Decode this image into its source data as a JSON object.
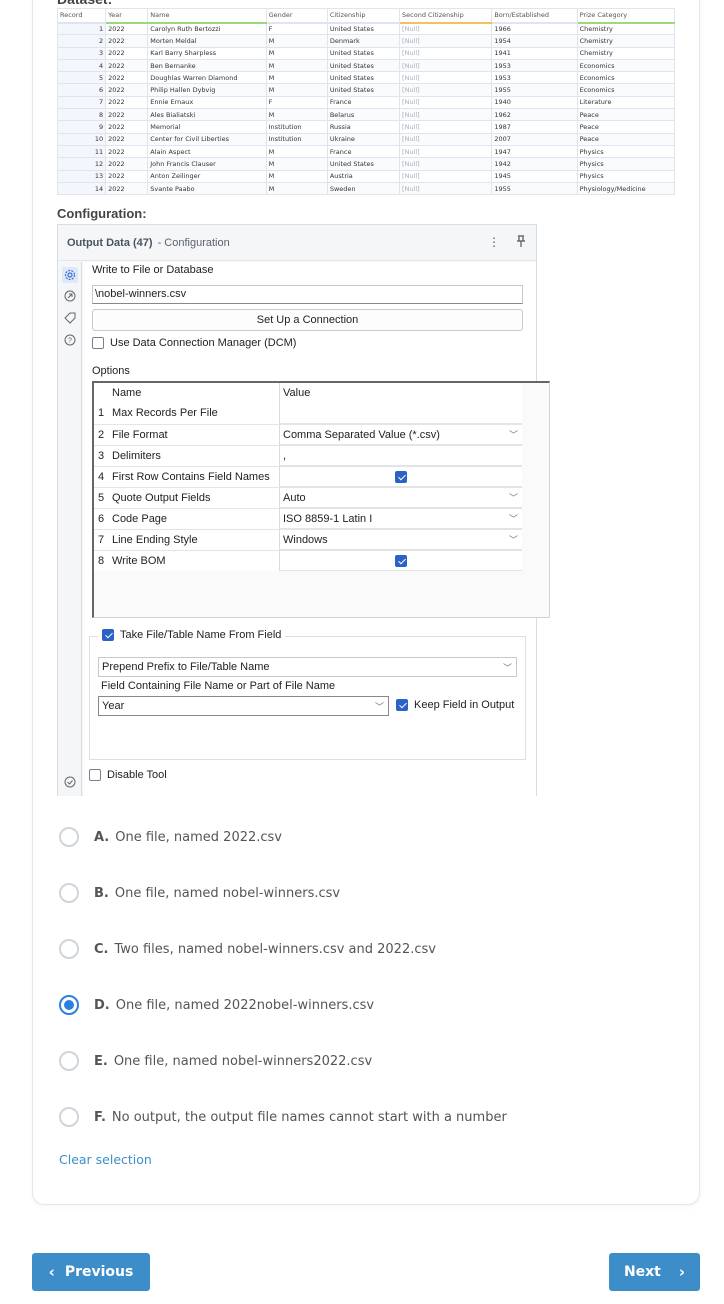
{
  "dataset": {
    "heading": "Dataset:",
    "columns": [
      "Record",
      "Year",
      "Name",
      "Gender",
      "Citizenship",
      "Second Citizenship",
      "Born/Established",
      "Prize Category"
    ],
    "rows": [
      [
        "1",
        "2022",
        "Carolyn Ruth Bertozzi",
        "F",
        "United States",
        "[Null]",
        "1966",
        "Chemistry"
      ],
      [
        "2",
        "2022",
        "Morten Meldal",
        "M",
        "Denmark",
        "[Null]",
        "1954",
        "Chemistry"
      ],
      [
        "3",
        "2022",
        "Karl Barry Sharpless",
        "M",
        "United States",
        "[Null]",
        "1941",
        "Chemistry"
      ],
      [
        "4",
        "2022",
        "Ben Bernanke",
        "M",
        "United States",
        "[Null]",
        "1953",
        "Economics"
      ],
      [
        "5",
        "2022",
        "Doughlas Warren Diamond",
        "M",
        "United States",
        "[Null]",
        "1953",
        "Economics"
      ],
      [
        "6",
        "2022",
        "Philip Hallen Dybvig",
        "M",
        "United States",
        "[Null]",
        "1955",
        "Economics"
      ],
      [
        "7",
        "2022",
        "Ennie Ernaux",
        "F",
        "France",
        "[Null]",
        "1940",
        "Literature"
      ],
      [
        "8",
        "2022",
        "Ales Bialiatski",
        "M",
        "Belarus",
        "[Null]",
        "1962",
        "Peace"
      ],
      [
        "9",
        "2022",
        "Memorial",
        "Institution",
        "Russia",
        "[Null]",
        "1987",
        "Peace"
      ],
      [
        "10",
        "2022",
        "Center for Civil Liberties",
        "Institution",
        "Ukraine",
        "[Null]",
        "2007",
        "Peace"
      ],
      [
        "11",
        "2022",
        "Alain Aspect",
        "M",
        "France",
        "[Null]",
        "1947",
        "Physics"
      ],
      [
        "12",
        "2022",
        "John Francis Clauser",
        "M",
        "United States",
        "[Null]",
        "1942",
        "Physics"
      ],
      [
        "13",
        "2022",
        "Anton Zeilinger",
        "M",
        "Austria",
        "[Null]",
        "1945",
        "Physics"
      ],
      [
        "14",
        "2022",
        "Svante Paabo",
        "M",
        "Sweden",
        "[Null]",
        "1955",
        "Physiology/Medicine"
      ]
    ]
  },
  "configuration": {
    "heading": "Configuration:",
    "panel_title": "Output Data (47)",
    "panel_subtitle": "- Configuration",
    "write_label": "Write to File or Database",
    "file_path": "\\nobel-winners.csv",
    "setup_button": "Set Up a Connection",
    "dcm_label": "Use Data Connection Manager (DCM)",
    "dcm_checked": false,
    "options_label": "Options",
    "options_header": {
      "name": "Name",
      "value": "Value"
    },
    "options": [
      {
        "num": "1",
        "name": "Max Records Per File",
        "value": "",
        "type": "text"
      },
      {
        "num": "2",
        "name": "File Format",
        "value": "Comma Separated Value (*.csv)",
        "type": "select"
      },
      {
        "num": "3",
        "name": "Delimiters",
        "value": ",",
        "type": "text"
      },
      {
        "num": "4",
        "name": "First Row Contains Field Names",
        "value": "true",
        "type": "checkbox"
      },
      {
        "num": "5",
        "name": "Quote Output Fields",
        "value": "Auto",
        "type": "select"
      },
      {
        "num": "6",
        "name": "Code Page",
        "value": "ISO 8859-1 Latin I",
        "type": "select"
      },
      {
        "num": "7",
        "name": "Line Ending Style",
        "value": "Windows",
        "type": "select"
      },
      {
        "num": "8",
        "name": "Write BOM",
        "value": "true",
        "type": "checkbox"
      }
    ],
    "take_name_label": "Take File/Table Name From Field",
    "take_name_checked": true,
    "name_mode": "Prepend Prefix to File/Table Name",
    "field_label": "Field Containing File Name or Part of File Name",
    "field_value": "Year",
    "keep_field_label": "Keep Field in Output",
    "keep_field_checked": true,
    "disable_tool_label": "Disable Tool",
    "disable_tool_checked": false
  },
  "quiz": {
    "options": [
      {
        "letter": "A.",
        "text": "One file, named 2022.csv",
        "selected": false
      },
      {
        "letter": "B.",
        "text": "One file, named nobel-winners.csv",
        "selected": false
      },
      {
        "letter": "C.",
        "text": "Two files, named nobel-winners.csv and 2022.csv",
        "selected": false
      },
      {
        "letter": "D.",
        "text": "One file, named 2022nobel-winners.csv",
        "selected": true
      },
      {
        "letter": "E.",
        "text": "One file, named nobel-winners2022.csv",
        "selected": false
      },
      {
        "letter": "F.",
        "text": "No output, the output file names cannot start with a number",
        "selected": false
      }
    ],
    "clear_label": "Clear selection"
  },
  "nav": {
    "previous_label": "Previous",
    "next_label": "Next"
  },
  "colors": {
    "accent": "#3d8ec8",
    "radio_selected": "#2d80e0",
    "checkbox": "#2a62c5"
  }
}
